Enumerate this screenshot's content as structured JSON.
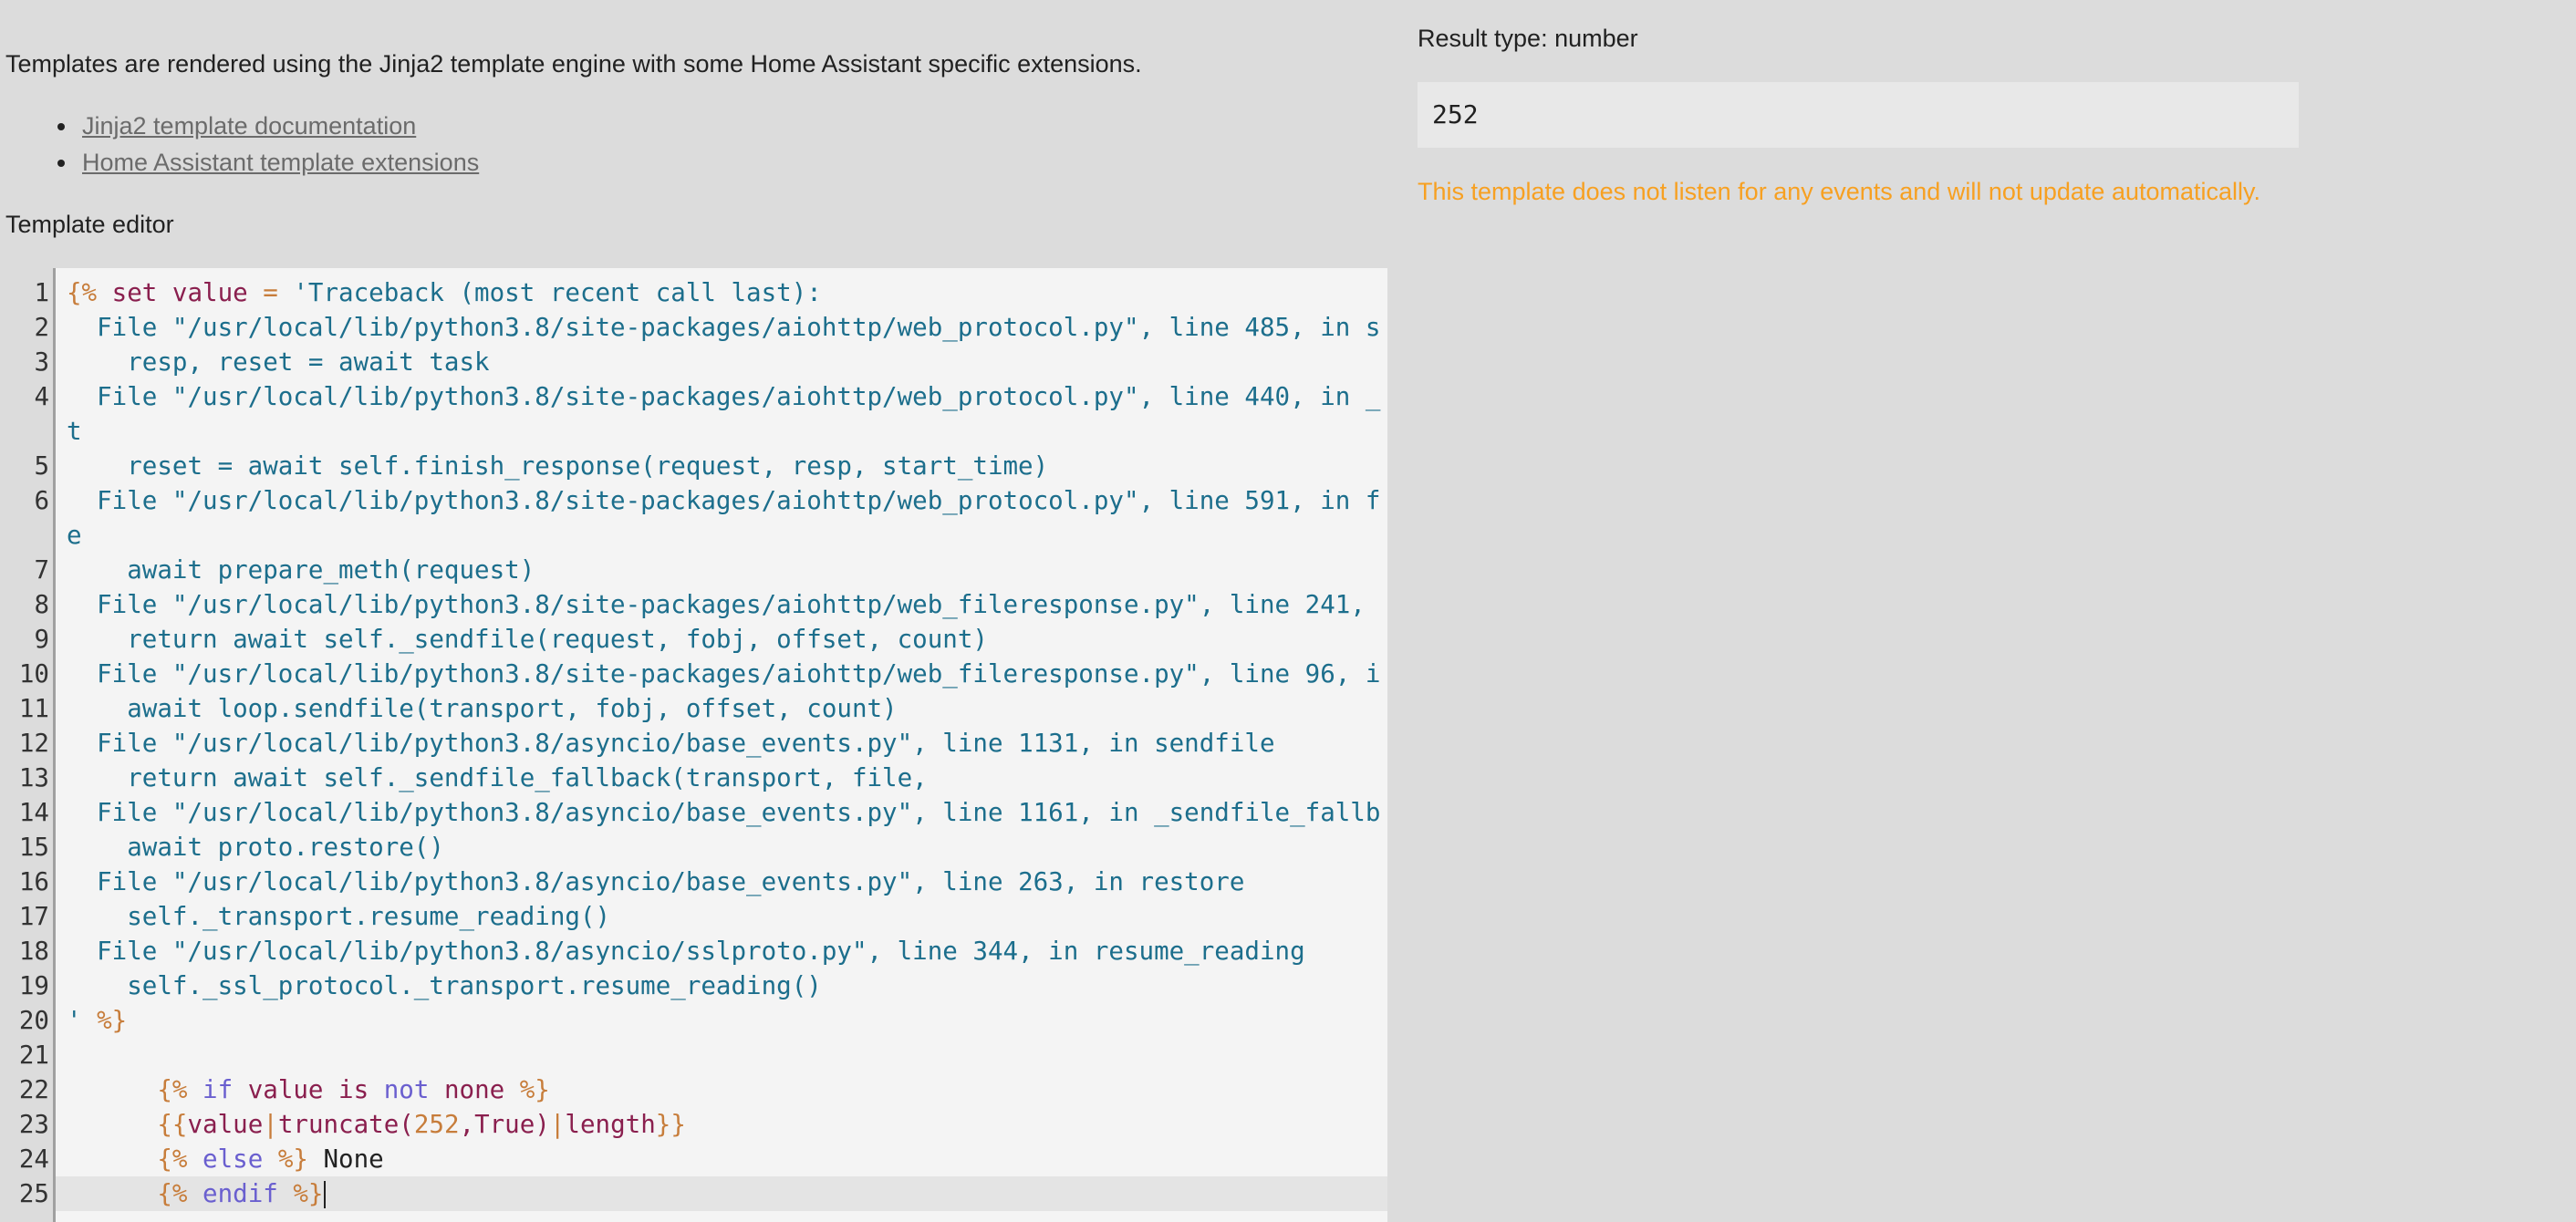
{
  "intro": {
    "text": "Templates are rendered using the Jinja2 template engine with some Home Assistant specific extensions.",
    "links": [
      {
        "label": "Jinja2 template documentation"
      },
      {
        "label": "Home Assistant template extensions"
      }
    ]
  },
  "editor": {
    "label": "Template editor",
    "lines": [
      {
        "n": "1",
        "segs": [
          {
            "t": "{%",
            "c": "delim"
          },
          {
            "t": " set value ",
            "c": "kw"
          },
          {
            "t": "=",
            "c": "delim"
          },
          {
            "t": " 'Traceback (most recent call last):",
            "c": "str"
          }
        ]
      },
      {
        "n": "2",
        "segs": [
          {
            "t": "  File \"/usr/local/lib/python3.8/site-packages/aiohttp/web_protocol.py\", line 485, in s",
            "c": "str"
          }
        ]
      },
      {
        "n": "3",
        "segs": [
          {
            "t": "    resp, reset = await task",
            "c": "str"
          }
        ]
      },
      {
        "n": "4",
        "segs": [
          {
            "t": "  File \"/usr/local/lib/python3.8/site-packages/aiohttp/web_protocol.py\", line 440, in _\nt",
            "c": "str"
          }
        ]
      },
      {
        "n": "5",
        "segs": [
          {
            "t": "    reset = await self.finish_response(request, resp, start_time)",
            "c": "str"
          }
        ]
      },
      {
        "n": "6",
        "segs": [
          {
            "t": "  File \"/usr/local/lib/python3.8/site-packages/aiohttp/web_protocol.py\", line 591, in f\ne",
            "c": "str"
          }
        ]
      },
      {
        "n": "7",
        "segs": [
          {
            "t": "    await prepare_meth(request)",
            "c": "str"
          }
        ]
      },
      {
        "n": "8",
        "segs": [
          {
            "t": "  File \"/usr/local/lib/python3.8/site-packages/aiohttp/web_fileresponse.py\", line 241, ",
            "c": "str"
          }
        ]
      },
      {
        "n": "9",
        "segs": [
          {
            "t": "    return await self._sendfile(request, fobj, offset, count)",
            "c": "str"
          }
        ]
      },
      {
        "n": "10",
        "segs": [
          {
            "t": "  File \"/usr/local/lib/python3.8/site-packages/aiohttp/web_fileresponse.py\", line 96, i",
            "c": "str"
          }
        ]
      },
      {
        "n": "11",
        "segs": [
          {
            "t": "    await loop.sendfile(transport, fobj, offset, count)",
            "c": "str"
          }
        ]
      },
      {
        "n": "12",
        "segs": [
          {
            "t": "  File \"/usr/local/lib/python3.8/asyncio/base_events.py\", line 1131, in sendfile",
            "c": "str"
          }
        ]
      },
      {
        "n": "13",
        "segs": [
          {
            "t": "    return await self._sendfile_fallback(transport, file,",
            "c": "str"
          }
        ]
      },
      {
        "n": "14",
        "segs": [
          {
            "t": "  File \"/usr/local/lib/python3.8/asyncio/base_events.py\", line 1161, in _sendfile_fallb",
            "c": "str"
          }
        ]
      },
      {
        "n": "15",
        "segs": [
          {
            "t": "    await proto.restore()",
            "c": "str"
          }
        ]
      },
      {
        "n": "16",
        "segs": [
          {
            "t": "  File \"/usr/local/lib/python3.8/asyncio/base_events.py\", line 263, in restore",
            "c": "str"
          }
        ]
      },
      {
        "n": "17",
        "segs": [
          {
            "t": "    self._transport.resume_reading()",
            "c": "str"
          }
        ]
      },
      {
        "n": "18",
        "segs": [
          {
            "t": "  File \"/usr/local/lib/python3.8/asyncio/sslproto.py\", line 344, in resume_reading",
            "c": "str"
          }
        ]
      },
      {
        "n": "19",
        "segs": [
          {
            "t": "    self._ssl_protocol._transport.resume_reading()",
            "c": "str"
          }
        ]
      },
      {
        "n": "20",
        "segs": [
          {
            "t": "' ",
            "c": "str"
          },
          {
            "t": "%}",
            "c": "delim"
          }
        ]
      },
      {
        "n": "21",
        "segs": [
          {
            "t": "",
            "c": "plain"
          }
        ]
      },
      {
        "n": "22",
        "segs": [
          {
            "t": "      ",
            "c": "plain"
          },
          {
            "t": "{%",
            "c": "delim"
          },
          {
            "t": " if ",
            "c": "kw2"
          },
          {
            "t": "value ",
            "c": "kw"
          },
          {
            "t": "is ",
            "c": "kw"
          },
          {
            "t": "not ",
            "c": "kw2"
          },
          {
            "t": "none ",
            "c": "kw"
          },
          {
            "t": "%}",
            "c": "delim"
          }
        ]
      },
      {
        "n": "23",
        "segs": [
          {
            "t": "      ",
            "c": "plain"
          },
          {
            "t": "{{",
            "c": "delim"
          },
          {
            "t": "value",
            "c": "kw"
          },
          {
            "t": "|",
            "c": "delim"
          },
          {
            "t": "truncate(",
            "c": "kw"
          },
          {
            "t": "252",
            "c": "num"
          },
          {
            "t": ",True)",
            "c": "kw"
          },
          {
            "t": "|",
            "c": "delim"
          },
          {
            "t": "length",
            "c": "kw"
          },
          {
            "t": "}}",
            "c": "delim"
          }
        ]
      },
      {
        "n": "24",
        "segs": [
          {
            "t": "      ",
            "c": "plain"
          },
          {
            "t": "{%",
            "c": "delim"
          },
          {
            "t": " else ",
            "c": "kw2"
          },
          {
            "t": "%}",
            "c": "delim"
          },
          {
            "t": " None",
            "c": "plain"
          }
        ]
      },
      {
        "n": "25",
        "segs": [
          {
            "t": "      ",
            "c": "plain"
          },
          {
            "t": "{%",
            "c": "delim"
          },
          {
            "t": " endif ",
            "c": "kw2"
          },
          {
            "t": "%}",
            "c": "delim"
          }
        ],
        "active": true,
        "cursor": true
      }
    ]
  },
  "result": {
    "type_label": "Result type: number",
    "value": "252",
    "warning": "This template does not listen for any events and will not update automatically."
  }
}
